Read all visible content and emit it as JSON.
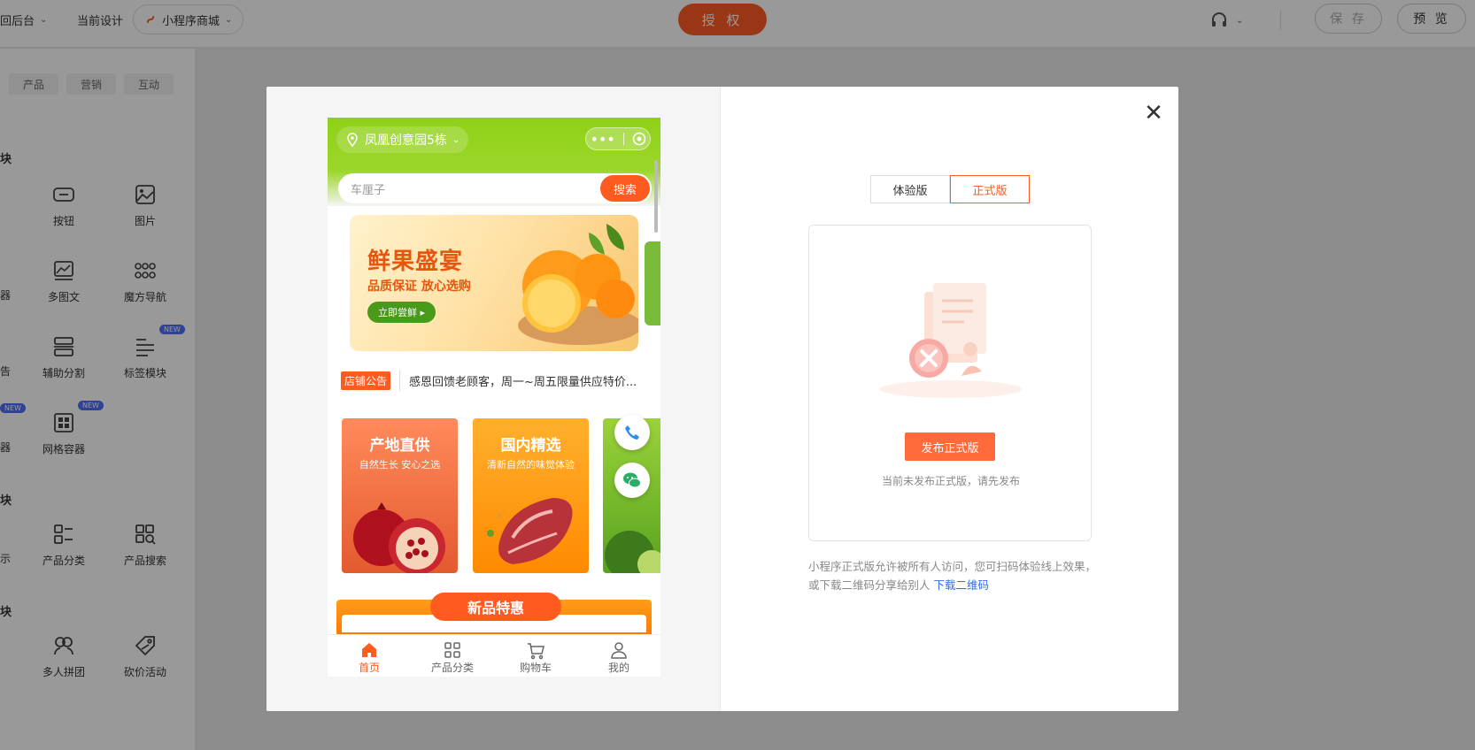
{
  "topbar": {
    "back_label": "回后台",
    "current_design_label": "当前设计",
    "project_name": "小程序商城",
    "auth_label": "授 权",
    "save_label": "保 存",
    "preview_label": "预 览"
  },
  "sidebar": {
    "tabs": [
      "产品",
      "营销",
      "互动"
    ],
    "section_titles": [
      "块",
      "块",
      "块"
    ],
    "cut_labels": [
      "器",
      "告",
      "器",
      "示"
    ],
    "components": [
      {
        "label": "按钮",
        "icon": "button-icon"
      },
      {
        "label": "图片",
        "icon": "image-icon"
      },
      {
        "label": "多图文",
        "icon": "multi-image-icon"
      },
      {
        "label": "魔方导航",
        "icon": "grid-dots-icon"
      },
      {
        "label": "辅助分割",
        "icon": "divider-icon"
      },
      {
        "label": "标签模块",
        "icon": "tag-list-icon"
      },
      {
        "label": "网格容器",
        "icon": "grid-container-icon"
      },
      {
        "label": "产品分类",
        "icon": "category-icon"
      },
      {
        "label": "产品搜索",
        "icon": "product-search-icon"
      },
      {
        "label": "多人拼团",
        "icon": "group-buy-icon"
      },
      {
        "label": "砍价活动",
        "icon": "bargain-icon"
      }
    ],
    "new_badge": "NEW"
  },
  "modal": {
    "phone": {
      "location": "凤凰创意园5栋",
      "capsule_dots": "•••",
      "search_placeholder": "车厘子",
      "search_button": "搜索",
      "banner": {
        "title": "鲜果盛宴",
        "subtitle": "品质保证 放心选购",
        "button": "立即尝鲜 ▸"
      },
      "notice_tag": "店铺公告",
      "notice_text": "感恩回馈老顾客，周一~周五限量供应特价...",
      "cards": [
        {
          "title": "产地直供",
          "subtitle": "自然生长 安心之选"
        },
        {
          "title": "国内精选",
          "subtitle": "清新自然的味觉体验"
        }
      ],
      "promo_title": "新品特惠",
      "tabbar": [
        {
          "label": "首页",
          "icon": "home-icon"
        },
        {
          "label": "产品分类",
          "icon": "category-icon"
        },
        {
          "label": "购物车",
          "icon": "cart-icon"
        },
        {
          "label": "我的",
          "icon": "user-icon"
        }
      ]
    },
    "version_tabs": [
      "体验版",
      "正式版"
    ],
    "active_version": "正式版",
    "publish_button": "发布正式版",
    "status_text": "当前未发布正式版，请先发布",
    "description": "小程序正式版允许被所有人访问，您可扫码体验线上效果，或下载二维码分享给别人",
    "download_link": "下载二维码",
    "close_symbol": "✕"
  },
  "colors": {
    "accent": "#ff5a1f",
    "phone_header": "#8fd117",
    "link": "#2f6ee6"
  }
}
